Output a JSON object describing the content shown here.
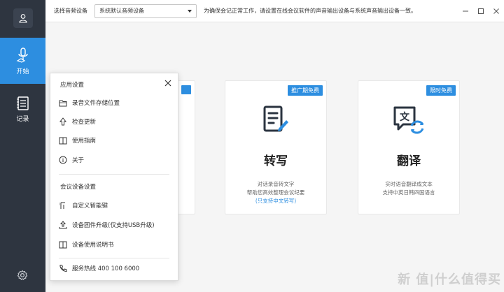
{
  "sidebar": {
    "items": [
      {
        "label": "开始",
        "icon": "microphone-hand-icon",
        "active": true
      },
      {
        "label": "记录",
        "icon": "notebook-icon",
        "active": false
      }
    ]
  },
  "topbar": {
    "device_label": "选择音频设备",
    "device_value": "系统默认音频设备",
    "notice": "为确保会记正常工作，请设置在线会议软件的声音输出设备与系统声音输出设备一致。"
  },
  "cards": [
    {
      "badge": "",
      "title": "",
      "desc1": "",
      "desc2": "",
      "desc3": ""
    },
    {
      "badge": "推广期免费",
      "title": "转写",
      "desc1": "对话录音转文字",
      "desc2": "帮助您高效整理会议纪要",
      "desc3": "(只支持中文转写)"
    },
    {
      "badge": "限时免费",
      "title": "翻译",
      "desc1": "实时语音翻译成文本",
      "desc2": "支持中英日韩四国语言",
      "desc3": ""
    }
  ],
  "popup": {
    "section1": "应用设置",
    "items1": [
      "录音文件存储位置",
      "检查更新",
      "使用指南",
      "关于"
    ],
    "section2": "会议设备设置",
    "items2": [
      "自定义智能键",
      "设备固件升级(仅支持USB升级)",
      "设备使用说明书"
    ],
    "hotline": "服务热线 400 100 6000"
  },
  "watermark": "新 值|什么值得买",
  "colors": {
    "accent": "#2d8ee0",
    "sidebar": "#2e3540"
  }
}
